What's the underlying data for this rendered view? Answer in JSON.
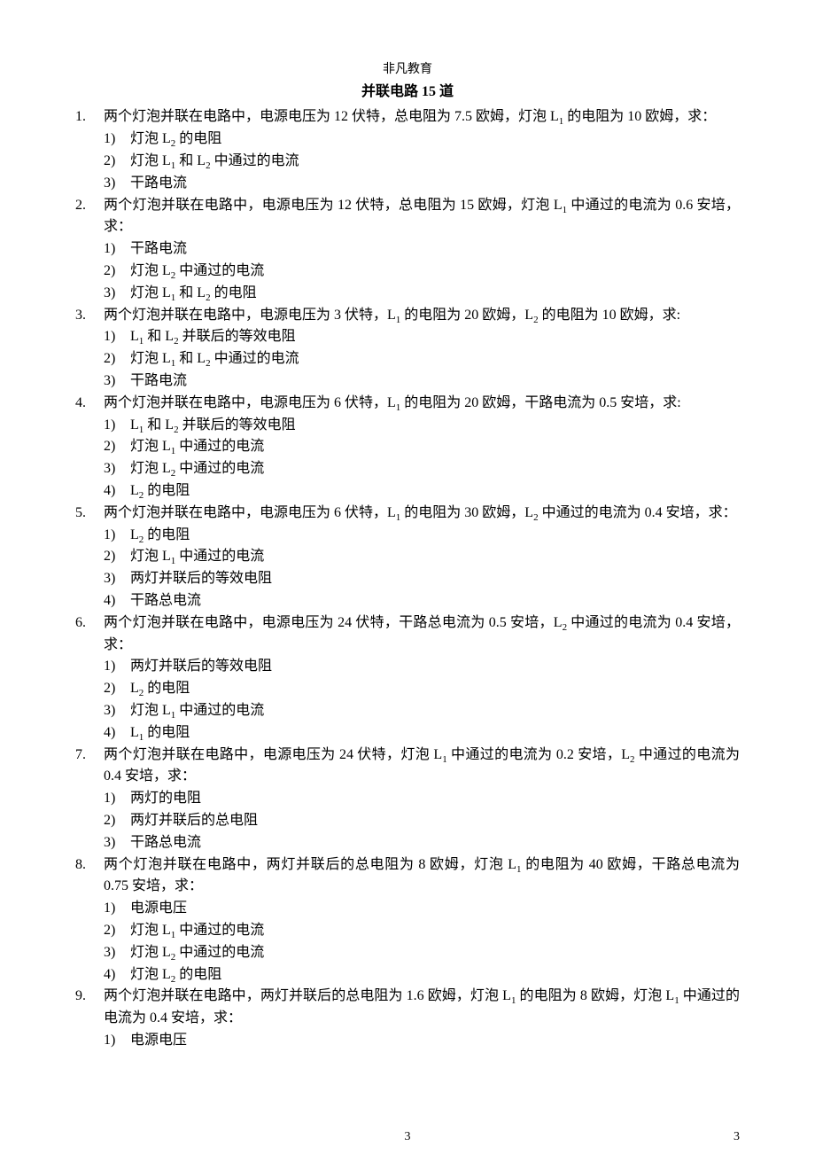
{
  "header": "非凡教育",
  "title": "并联电路 15 道",
  "problems": [
    {
      "num": "1.",
      "stem": "两个灯泡并联在电路中，电源电压为 12 伏特，总电阻为 7.5 欧姆，灯泡 L|1| 的电阻为 10 欧姆，求：",
      "subs": [
        {
          "num": "1)",
          "text": "灯泡 L|2| 的电阻"
        },
        {
          "num": "2)",
          "text": "灯泡 L|1| 和 L|2| 中通过的电流"
        },
        {
          "num": "3)",
          "text": "干路电流"
        }
      ]
    },
    {
      "num": "2.",
      "stem": "两个灯泡并联在电路中，电源电压为 12 伏特，总电阻为 15 欧姆，灯泡 L|1| 中通过的电流为 0.6 安培，求：",
      "subs": [
        {
          "num": "1)",
          "text": "干路电流"
        },
        {
          "num": "2)",
          "text": "灯泡 L|2| 中通过的电流"
        },
        {
          "num": "3)",
          "text": "灯泡 L|1| 和 L|2| 的电阻"
        }
      ]
    },
    {
      "num": "3.",
      "stem": "两个灯泡并联在电路中，电源电压为 3 伏特，L|1| 的电阻为 20 欧姆，L|2| 的电阻为 10 欧姆，求:",
      "subs": [
        {
          "num": "1)",
          "text": "L|1| 和 L|2| 并联后的等效电阻"
        },
        {
          "num": "2)",
          "text": "灯泡 L|1| 和 L|2| 中通过的电流"
        },
        {
          "num": "3)",
          "text": "干路电流"
        }
      ]
    },
    {
      "num": "4.",
      "stem": "两个灯泡并联在电路中，电源电压为 6 伏特，L|1| 的电阻为 20 欧姆，干路电流为 0.5 安培，求:",
      "subs": [
        {
          "num": "1)",
          "text": "L|1| 和 L|2| 并联后的等效电阻"
        },
        {
          "num": "2)",
          "text": "灯泡 L|1| 中通过的电流"
        },
        {
          "num": "3)",
          "text": "灯泡 L|2| 中通过的电流"
        },
        {
          "num": "4)",
          "text": "L|2| 的电阻"
        }
      ]
    },
    {
      "num": "5.",
      "stem": "两个灯泡并联在电路中，电源电压为 6 伏特，L|1| 的电阻为 30 欧姆，L|2| 中通过的电流为 0.4 安培，求：",
      "subs": [
        {
          "num": "1)",
          "text": "L|2| 的电阻"
        },
        {
          "num": "2)",
          "text": "灯泡 L|1| 中通过的电流"
        },
        {
          "num": "3)",
          "text": "两灯并联后的等效电阻"
        },
        {
          "num": "4)",
          "text": "干路总电流"
        }
      ]
    },
    {
      "num": "6.",
      "stem": "两个灯泡并联在电路中，电源电压为 24 伏特，干路总电流为 0.5 安培，L|2| 中通过的电流为 0.4 安培，求：",
      "subs": [
        {
          "num": "1)",
          "text": "两灯并联后的等效电阻"
        },
        {
          "num": "2)",
          "text": "L|2| 的电阻"
        },
        {
          "num": "3)",
          "text": "灯泡 L|1| 中通过的电流"
        },
        {
          "num": "4)",
          "text": "L|1| 的电阻"
        }
      ]
    },
    {
      "num": "7.",
      "stem": "两个灯泡并联在电路中，电源电压为 24 伏特，灯泡 L|1| 中通过的电流为 0.2 安培，L|2| 中通过的电流为 0.4 安培，求：",
      "subs": [
        {
          "num": "1)",
          "text": "两灯的电阻"
        },
        {
          "num": "2)",
          "text": "两灯并联后的总电阻"
        },
        {
          "num": "3)",
          "text": "干路总电流"
        }
      ]
    },
    {
      "num": "8.",
      "stem": "两个灯泡并联在电路中，两灯并联后的总电阻为 8 欧姆，灯泡 L|1| 的电阻为 40 欧姆，干路总电流为 0.75 安培，求：",
      "subs": [
        {
          "num": "1)",
          "text": "电源电压"
        },
        {
          "num": "2)",
          "text": "灯泡 L|1| 中通过的电流"
        },
        {
          "num": "3)",
          "text": "灯泡 L|2| 中通过的电流"
        },
        {
          "num": "4)",
          "text": "灯泡 L|2| 的电阻"
        }
      ]
    },
    {
      "num": "9.",
      "stem": "两个灯泡并联在电路中，两灯并联后的总电阻为 1.6 欧姆，灯泡 L|1| 的电阻为 8 欧姆，灯泡 L|1| 中通过的电流为 0.4 安培，求：",
      "subs": [
        {
          "num": "1)",
          "text": "电源电压"
        }
      ]
    }
  ],
  "page_center": "3",
  "page_right": "3"
}
